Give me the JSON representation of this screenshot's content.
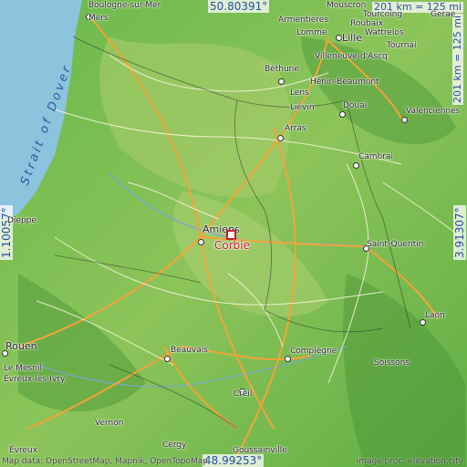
{
  "map": {
    "focus_city": "Corbie",
    "sea_label": "Strait of Dover",
    "coords": {
      "north": "50.80391°",
      "south": "48.99253°",
      "west": "1.10057°",
      "east": "3.91307°"
    },
    "scale": {
      "horizontal": "201 km = 125 mi",
      "vertical": "201 km = 125 mi"
    },
    "cities": [
      "Boulogne-sur-Mer",
      "Mouscron",
      "Tourcoing",
      "Gerae",
      "Armentières",
      "Lomme",
      "Lille",
      "Wattrelos",
      "Roubaix",
      "Tournai",
      "Villeneuve-d'Ascq",
      "Béthune",
      "Hénin-Beaumont",
      "Lens",
      "Liévin",
      "Douai",
      "Valenciennes",
      "Arras",
      "Cambrai",
      "Dieppe",
      "Amiens",
      "Saint-Quentin",
      "Laon",
      "Rouen",
      "Beauvais",
      "Compiègne",
      "Soissons",
      "Le Mesnil",
      "Creil",
      "Vernon",
      "Cergy",
      "Goussainville",
      "Évreux",
      "Évreux-les-Ivry",
      "Mers"
    ],
    "attribution": "Map data: OpenStreetMap, Mapnik, OpenTopoMap",
    "credit": "image proc: elevation.city"
  },
  "colors": {
    "sea": "#8cc3dd",
    "lowland": "#5ca840",
    "highland": "#a8cc6a",
    "road_major": "#f2a43a",
    "road_minor": "#ffffff",
    "border": "#222222",
    "highlight": "#c0202b"
  }
}
